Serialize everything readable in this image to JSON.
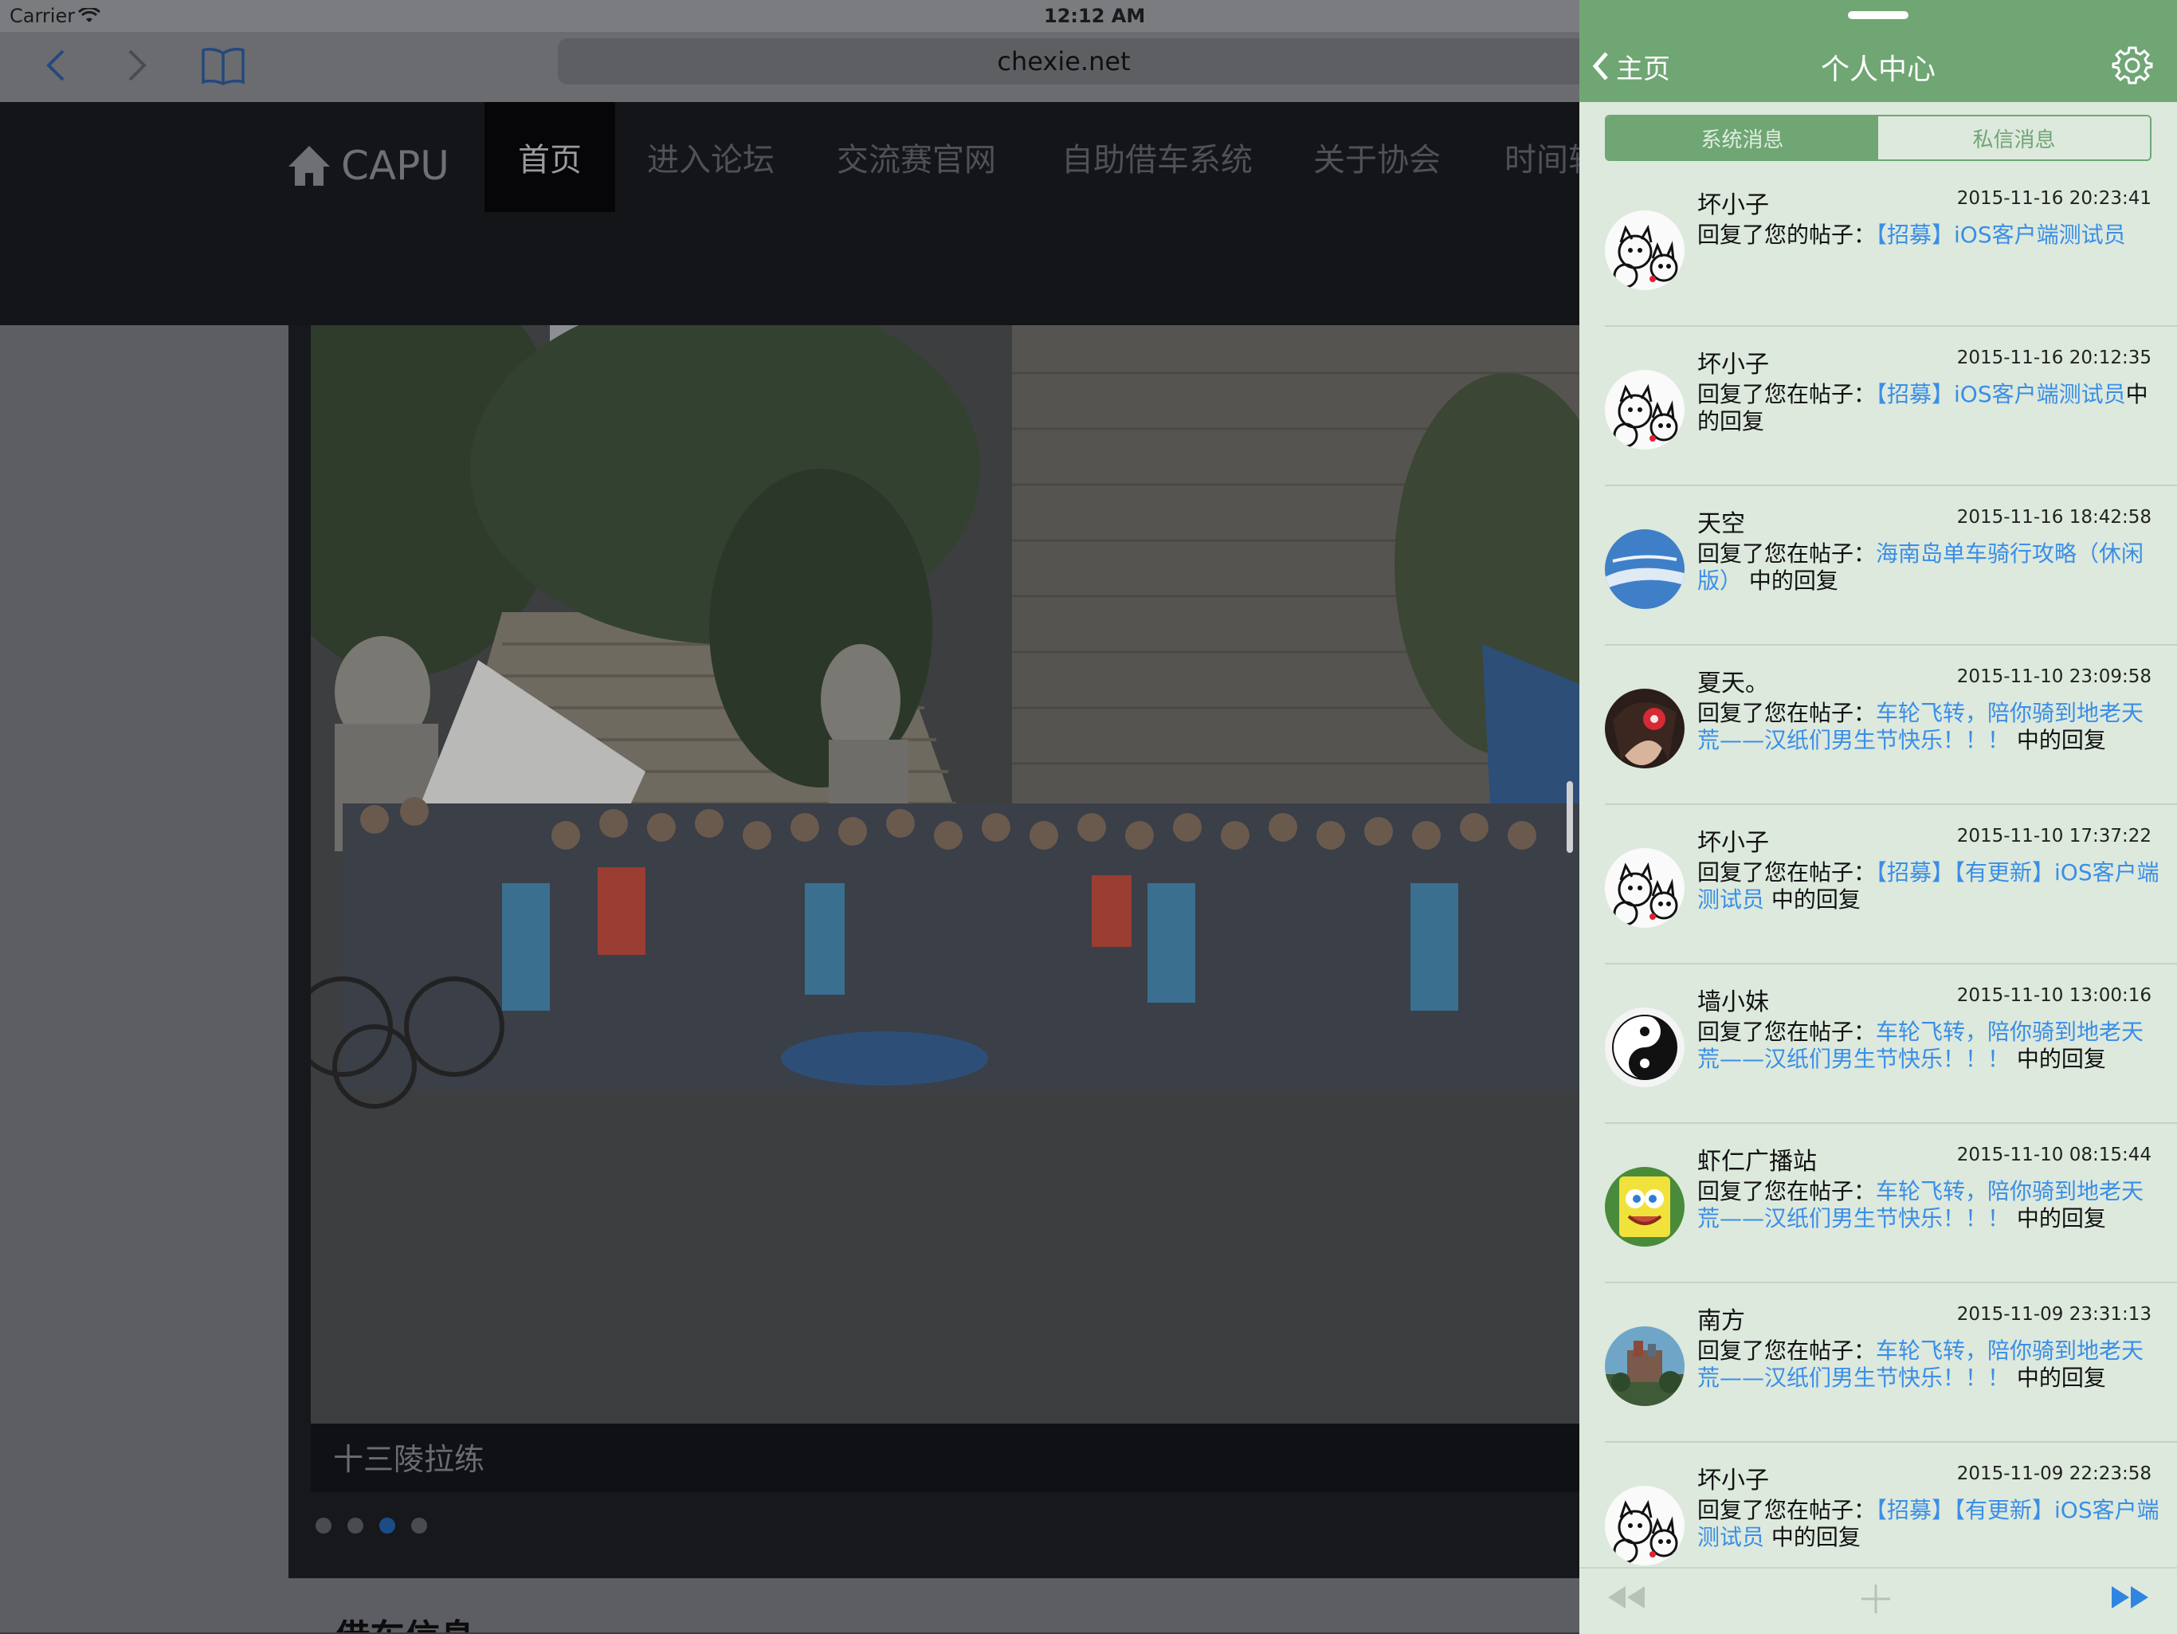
{
  "statusbar": {
    "carrier": "Carrier",
    "time": "12:12 AM"
  },
  "browser": {
    "url": "chexie.net"
  },
  "site": {
    "brand": "CAPU",
    "nav": [
      "首页",
      "进入论坛",
      "交流赛官网",
      "自助借车系统",
      "关于协会",
      "时间轴"
    ],
    "active_nav": 0,
    "slide_caption": "十三陵拉练",
    "slide_count": 4,
    "active_slide": 2,
    "below_heading": "借车信息"
  },
  "panel": {
    "back_label": "主页",
    "title": "个人中心",
    "tabs": [
      "系统消息",
      "私信消息"
    ],
    "active_tab": 0,
    "messages": [
      {
        "user": "坏小子",
        "time": "2015-11-16 20:23:41",
        "prefix": "回复了您的帖子：",
        "link": "【招募】iOS客户端测试员",
        "suffix": "",
        "avatar": "cats"
      },
      {
        "user": "坏小子",
        "time": "2015-11-16 20:12:35",
        "prefix": "回复了您在帖子：",
        "link": "【招募】iOS客户端测试员",
        "suffix": "中的回复",
        "avatar": "cats"
      },
      {
        "user": "天空",
        "time": "2015-11-16 18:42:58",
        "prefix": "回复了您在帖子：",
        "link": "海南岛单车骑行攻略（休闲版）",
        "suffix": " 中的回复",
        "avatar": "sky"
      },
      {
        "user": "夏天。",
        "time": "2015-11-10 23:09:58",
        "prefix": "回复了您在帖子：",
        "link": "车轮飞转，陪你骑到地老天荒——汉纸们男生节快乐！！！",
        "suffix": " 中的回复",
        "avatar": "girl"
      },
      {
        "user": "坏小子",
        "time": "2015-11-10 17:37:22",
        "prefix": "回复了您在帖子：",
        "link": "【招募】【有更新】iOS客户端测试员",
        "suffix": " 中的回复",
        "avatar": "cats"
      },
      {
        "user": "墙小妹",
        "time": "2015-11-10 13:00:16",
        "prefix": "回复了您在帖子：",
        "link": "车轮飞转，陪你骑到地老天荒——汉纸们男生节快乐！！！",
        "suffix": " 中的回复",
        "avatar": "yinyang"
      },
      {
        "user": "虾仁广播站",
        "time": "2015-11-10 08:15:44",
        "prefix": "回复了您在帖子：",
        "link": "车轮飞转，陪你骑到地老天荒——汉纸们男生节快乐！！！",
        "suffix": " 中的回复",
        "avatar": "sponge"
      },
      {
        "user": "南方",
        "time": "2015-11-09 23:31:13",
        "prefix": "回复了您在帖子：",
        "link": "车轮飞转，陪你骑到地老天荒——汉纸们男生节快乐！！！",
        "suffix": " 中的回复",
        "avatar": "castle"
      },
      {
        "user": "坏小子",
        "time": "2015-11-09 22:23:58",
        "prefix": "回复了您在帖子：",
        "link": "【招募】【有更新】iOS客户端测试员",
        "suffix": " 中的回复",
        "avatar": "cats"
      }
    ]
  }
}
